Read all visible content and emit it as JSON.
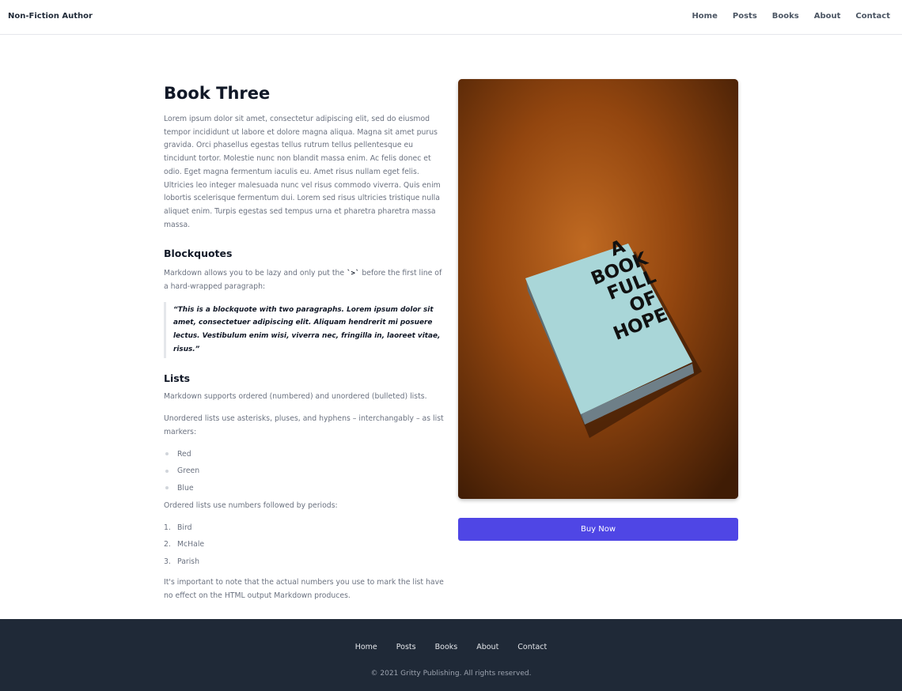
{
  "header": {
    "brand": "Non-Fiction Author",
    "nav": [
      "Home",
      "Posts",
      "Books",
      "About",
      "Contact"
    ]
  },
  "book": {
    "title": "Book Three",
    "intro": "Lorem ipsum dolor sit amet, consectetur adipiscing elit, sed do eiusmod tempor incididunt ut labore et dolore magna aliqua. Magna sit amet purus gravida. Orci phasellus egestas tellus rutrum tellus pellentesque eu tincidunt tortor. Molestie nunc non blandit massa enim. Ac felis donec et odio. Eget magna fermentum iaculis eu. Amet risus nullam eget felis. Ultricies leo integer malesuada nunc vel risus commodo viverra. Quis enim lobortis scelerisque fermentum dui. Lorem sed risus ultricies tristique nulla aliquet enim. Turpis egestas sed tempus urna et pharetra pharetra massa massa.",
    "blockquotes_heading": "Blockquotes",
    "blockquotes_text_before": "Markdown allows you to be lazy and only put the ",
    "blockquotes_code": "`>`",
    "blockquotes_text_after": " before the first line of a hard-wrapped paragraph:",
    "quote": "“This is a blockquote with two paragraphs. Lorem ipsum dolor sit amet, consectetuer adipiscing elit. Aliquam hendrerit mi posuere lectus. Vestibulum enim wisi, viverra nec, fringilla in, laoreet vitae, risus.”",
    "lists_heading": "Lists",
    "lists_intro": "Markdown supports ordered (numbered) and unordered (bulleted) lists.",
    "unordered_intro": "Unordered lists use asterisks, pluses, and hyphens – interchangably – as list markers:",
    "unordered": [
      "Red",
      "Green",
      "Blue"
    ],
    "ordered_intro": "Ordered lists use numbers followed by periods:",
    "ordered": [
      {
        "num": "1.",
        "text": "Bird"
      },
      {
        "num": "2.",
        "text": "McHale"
      },
      {
        "num": "3.",
        "text": "Parish"
      }
    ],
    "closing": "It's important to note that the actual numbers you use to mark the list have no effect on the HTML output Markdown produces.",
    "cover_text": [
      "A",
      "BOOK",
      "FULL",
      "OF",
      "HOPE"
    ],
    "buy_label": "Buy Now"
  },
  "footer": {
    "nav": [
      "Home",
      "Posts",
      "Books",
      "About",
      "Contact"
    ],
    "copyright": "© 2021 Gritty Publishing. All rights reserved."
  },
  "colors": {
    "accent": "#4f46e5",
    "footer_bg": "#1f2937",
    "cover_bg": "#9a4e14",
    "book_cover": "#a9d6d8"
  }
}
